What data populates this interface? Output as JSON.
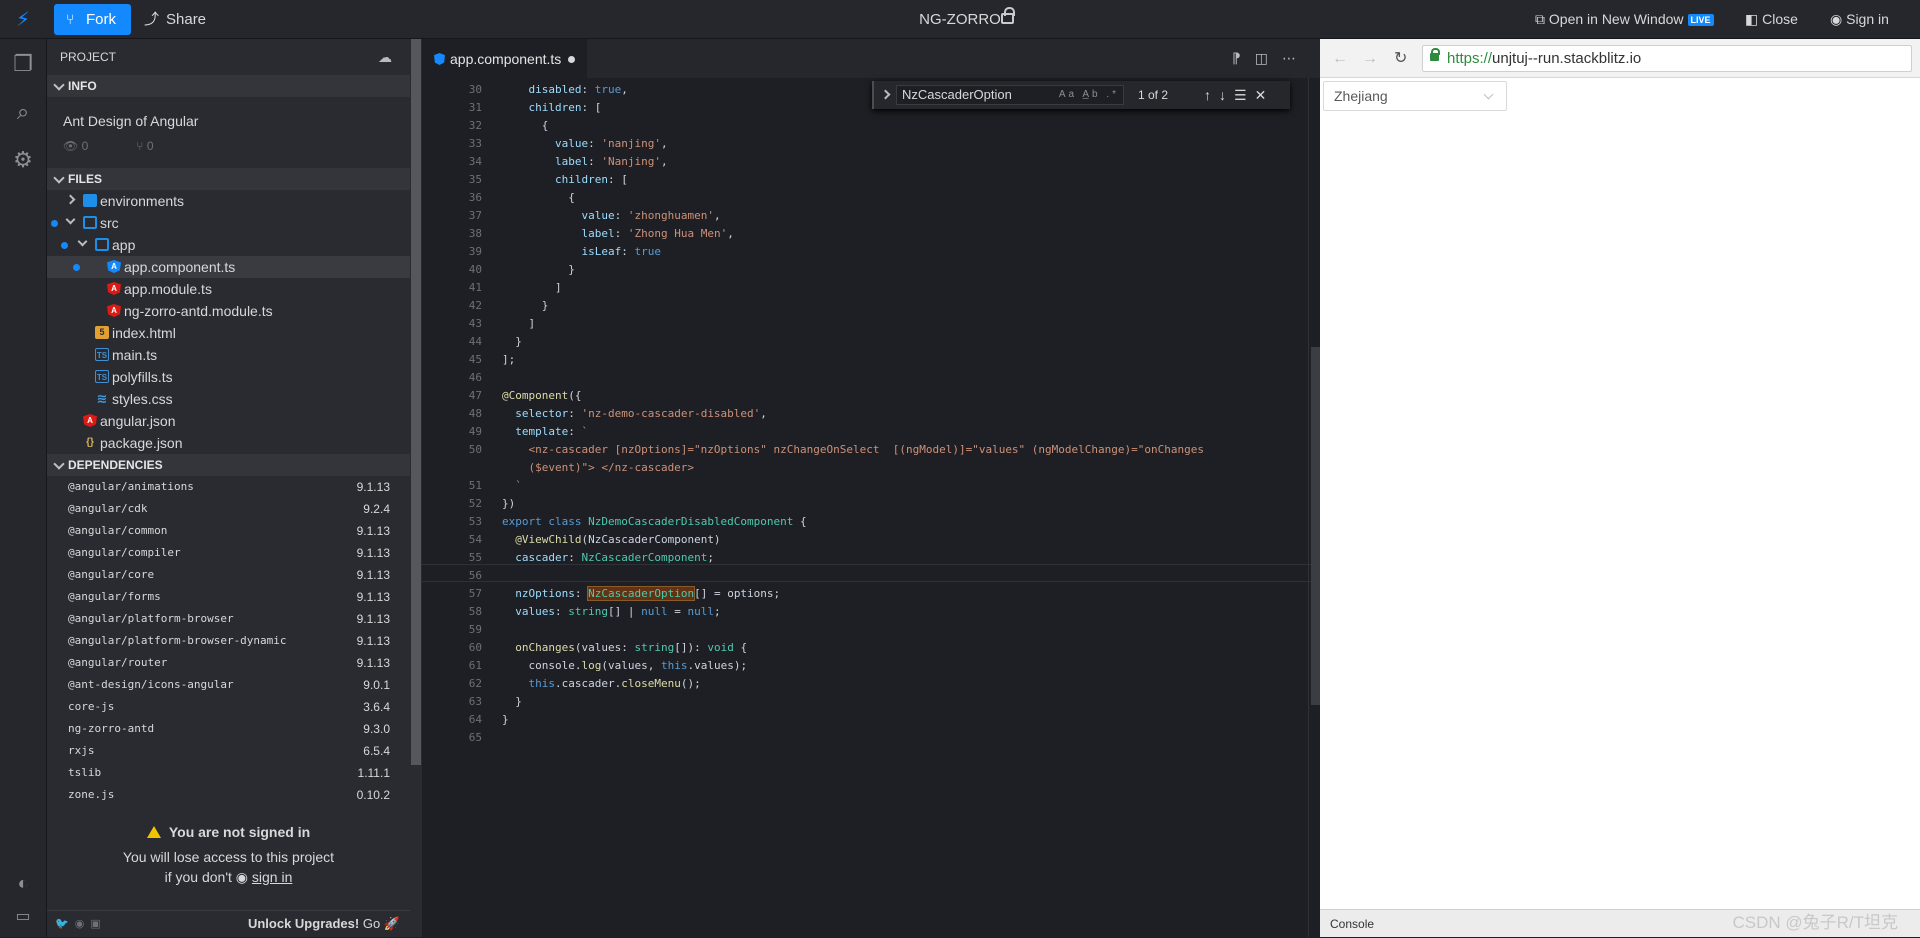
{
  "topbar": {
    "fork_label": "Fork",
    "share_label": "Share",
    "project_title": "NG-ZORRO",
    "open_new_window": "Open in New Window",
    "live_badge": "LIVE",
    "close_label": "Close",
    "signin_label": "Sign in"
  },
  "sidebar": {
    "project_header": "PROJECT",
    "info_header": "INFO",
    "info_title": "Ant Design of Angular",
    "views": "0",
    "forks": "0",
    "files_header": "FILES",
    "files": [
      {
        "name": "environments",
        "type": "folder"
      },
      {
        "name": "src",
        "type": "folder-open"
      },
      {
        "name": "app",
        "type": "folder-open"
      },
      {
        "name": "app.component.ts",
        "type": "angular-blue"
      },
      {
        "name": "app.module.ts",
        "type": "angular"
      },
      {
        "name": "ng-zorro-antd.module.ts",
        "type": "angular"
      },
      {
        "name": "index.html",
        "type": "html"
      },
      {
        "name": "main.ts",
        "type": "ts"
      },
      {
        "name": "polyfills.ts",
        "type": "ts"
      },
      {
        "name": "styles.css",
        "type": "css"
      },
      {
        "name": "angular.json",
        "type": "angular"
      },
      {
        "name": "package.json",
        "type": "json"
      }
    ],
    "deps_header": "DEPENDENCIES",
    "dependencies": [
      {
        "name": "@angular/animations",
        "version": "9.1.13"
      },
      {
        "name": "@angular/cdk",
        "version": "9.2.4"
      },
      {
        "name": "@angular/common",
        "version": "9.1.13"
      },
      {
        "name": "@angular/compiler",
        "version": "9.1.13"
      },
      {
        "name": "@angular/core",
        "version": "9.1.13"
      },
      {
        "name": "@angular/forms",
        "version": "9.1.13"
      },
      {
        "name": "@angular/platform-browser",
        "version": "9.1.13"
      },
      {
        "name": "@angular/platform-browser-dynamic",
        "version": "9.1.13"
      },
      {
        "name": "@angular/router",
        "version": "9.1.13"
      },
      {
        "name": "@ant-design/icons-angular",
        "version": "9.0.1"
      },
      {
        "name": "core-js",
        "version": "3.6.4"
      },
      {
        "name": "ng-zorro-antd",
        "version": "9.3.0"
      },
      {
        "name": "rxjs",
        "version": "6.5.4"
      },
      {
        "name": "tslib",
        "version": "1.11.1"
      },
      {
        "name": "zone.js",
        "version": "0.10.2"
      }
    ],
    "not_signed_in": "You are not signed in",
    "lose_access": "You will lose access to this project",
    "if_you_dont": "if you don't",
    "sign_in_link": "sign in",
    "unlock": "Unlock Upgrades!",
    "go": "Go"
  },
  "editor": {
    "tab_label": "app.component.ts",
    "find_query": "NzCascaderOption",
    "find_count": "1 of 2",
    "line_numbers": [
      "30",
      "31",
      "32",
      "33",
      "34",
      "35",
      "36",
      "37",
      "38",
      "39",
      "40",
      "41",
      "42",
      "43",
      "44",
      "45",
      "46",
      "47",
      "48",
      "49",
      "50",
      "",
      "51",
      "52",
      "53",
      "54",
      "55",
      "56",
      "57",
      "58",
      "59",
      "60",
      "61",
      "62",
      "63",
      "64",
      "65"
    ]
  },
  "preview": {
    "url_https": "https://",
    "url_rest": "unjtuj--run.stackblitz.io",
    "select_value": "Zhejiang",
    "console_label": "Console"
  },
  "watermark": "CSDN @兔子R/T坦克",
  "colors": {
    "accent": "#1389fd",
    "bg": "#1e1f24",
    "sidebar": "#2a2b30"
  }
}
